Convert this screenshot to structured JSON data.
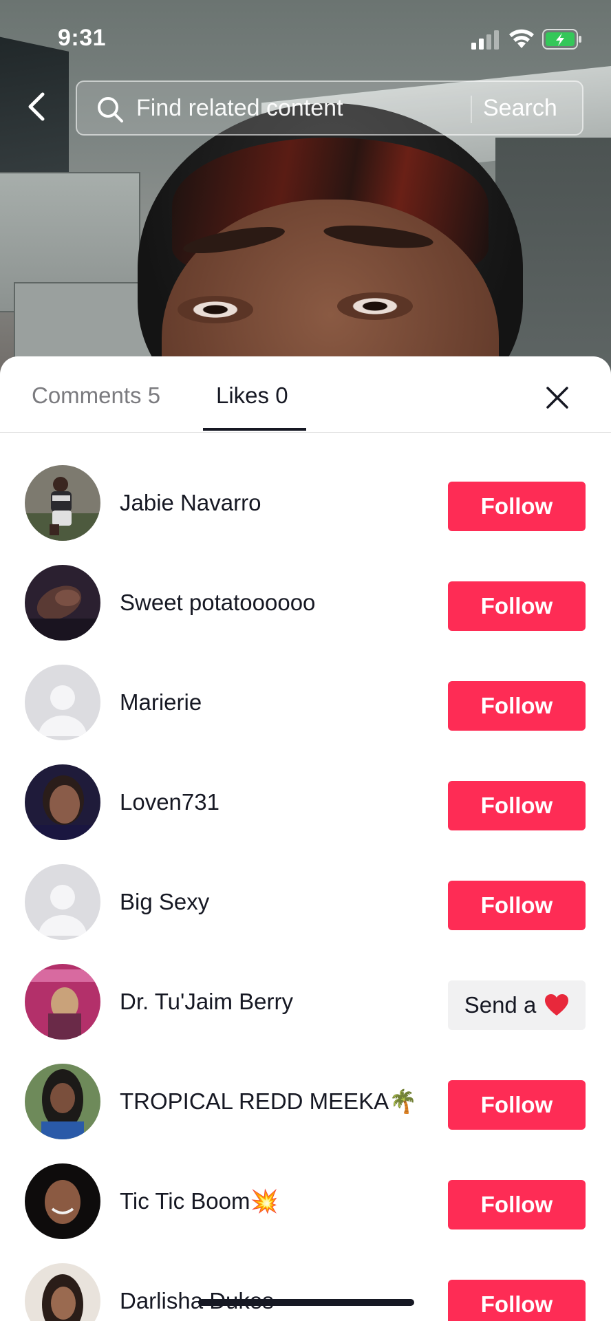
{
  "status_bar": {
    "time": "9:31"
  },
  "search": {
    "placeholder": "Find related content",
    "button_label": "Search"
  },
  "tabs": [
    {
      "label": "Comments 5",
      "selected": false
    },
    {
      "label": "Likes 0",
      "selected": true
    }
  ],
  "colors": {
    "accent": "#fe2c55",
    "text": "#161823",
    "muted": "#7b7b7f",
    "secondary_button": "#f1f1f2"
  },
  "likes_list": [
    {
      "name": "Jabie Navarro",
      "action": "Follow",
      "avatar": "photo"
    },
    {
      "name": "Sweet potatoooooo",
      "action": "Follow",
      "avatar": "photo"
    },
    {
      "name": "Marierie",
      "action": "Follow",
      "avatar": "default-avatar-icon"
    },
    {
      "name": "Loven731",
      "action": "Follow",
      "avatar": "photo"
    },
    {
      "name": "Big Sexy",
      "action": "Follow",
      "avatar": "default-avatar-icon"
    },
    {
      "name": "Dr. Tu'Jaim Berry",
      "action": "Send a",
      "action_icon": "heart-icon",
      "avatar": "photo"
    },
    {
      "name": "TROPICAL REDD MEEKA🌴",
      "action": "Follow",
      "avatar": "photo"
    },
    {
      "name": "Tic Tic Boom💥",
      "action": "Follow",
      "avatar": "photo"
    },
    {
      "name": "Darlisha Dukes",
      "action": "Follow",
      "avatar": "photo"
    }
  ]
}
